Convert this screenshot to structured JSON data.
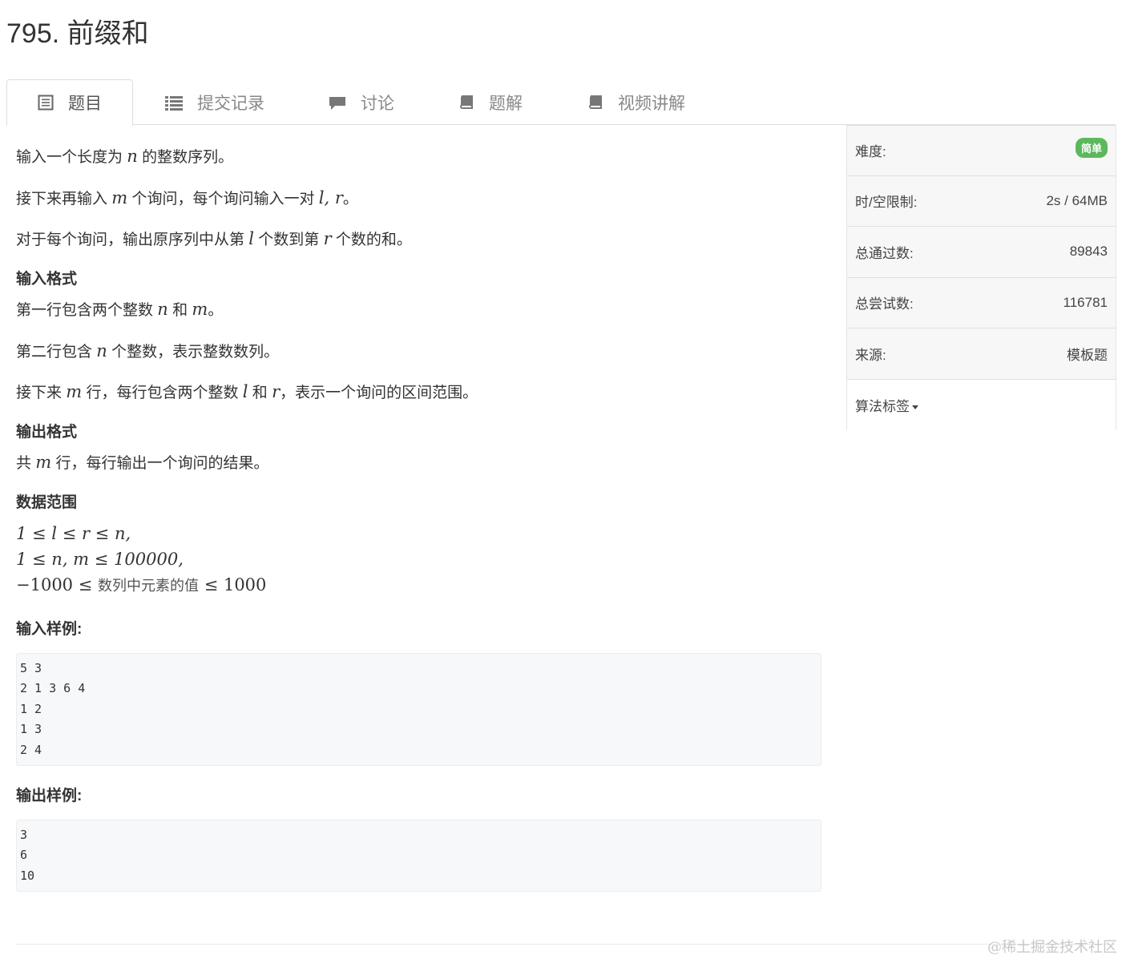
{
  "problem": {
    "title": "795. 前缀和"
  },
  "tabs": [
    {
      "label": "题目",
      "icon": "document-icon"
    },
    {
      "label": "提交记录",
      "icon": "list-icon"
    },
    {
      "label": "讨论",
      "icon": "comment-icon"
    },
    {
      "label": "题解",
      "icon": "book-icon"
    },
    {
      "label": "视频讲解",
      "icon": "book-icon"
    }
  ],
  "description": {
    "p1_a": "输入一个长度为",
    "p1_n": "n",
    "p1_b": "的整数序列。",
    "p2_a": "接下来再输入",
    "p2_m": "m",
    "p2_b": "个询问，每个询问输入一对",
    "p2_lr": "l, r",
    "p2_c": "。",
    "p3_a": "对于每个询问，输出原序列中从第",
    "p3_l": "l",
    "p3_b": "个数到第",
    "p3_r": "r",
    "p3_c": "个数的和。"
  },
  "input_format": {
    "heading": "输入格式",
    "l1_a": "第一行包含两个整数",
    "l1_n": "n",
    "l1_b": "和",
    "l1_m": "m",
    "l1_c": "。",
    "l2_a": "第二行包含",
    "l2_n": "n",
    "l2_b": "个整数，表示整数数列。",
    "l3_a": "接下来",
    "l3_m": "m",
    "l3_b": "行，每行包含两个整数",
    "l3_l": "l",
    "l3_c": "和",
    "l3_r": "r",
    "l3_d": "，表示一个询问的区间范围。"
  },
  "output_format": {
    "heading": "输出格式",
    "l1_a": "共",
    "l1_m": "m",
    "l1_b": "行，每行输出一个询问的结果。"
  },
  "data_range": {
    "heading": "数据范围",
    "line1": "1 ≤ l ≤ r ≤ n,",
    "line2": "1 ≤ n, m ≤ 100000,",
    "line3_a": "−1000 ≤",
    "line3_cn": "数列中元素的值",
    "line3_b": "≤ 1000"
  },
  "sample_input": {
    "heading": "输入样例:",
    "text": "5 3\n2 1 3 6 4\n1 2\n1 3\n2 4"
  },
  "sample_output": {
    "heading": "输出样例:",
    "text": "3\n6\n10"
  },
  "sidebar": {
    "difficulty_label": "难度:",
    "difficulty_value": "简单",
    "difficulty_color": "#5cb85c",
    "limit_label": "时/空限制:",
    "limit_value": "2s / 64MB",
    "passed_label": "总通过数:",
    "passed_value": "89843",
    "attempts_label": "总尝试数:",
    "attempts_value": "116781",
    "source_label": "来源:",
    "source_value": "模板题",
    "tags_label": "算法标签"
  },
  "watermark": "@稀土掘金技术社区"
}
